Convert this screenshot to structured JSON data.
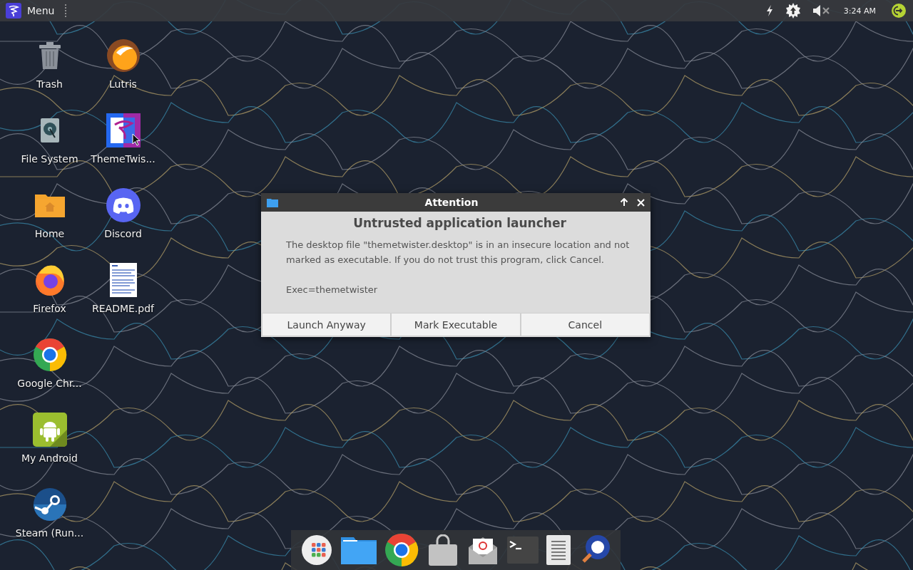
{
  "panel": {
    "menu_label": "Menu",
    "tray": [
      {
        "kind": "bolt"
      },
      {
        "kind": "update"
      },
      {
        "kind": "muted"
      }
    ],
    "clock": "3:24 AM"
  },
  "desktop_icons": [
    {
      "label": "Trash",
      "kind": "trash"
    },
    {
      "label": "File System",
      "kind": "drive"
    },
    {
      "label": "Home",
      "kind": "home"
    },
    {
      "label": "Firefox",
      "kind": "firefox"
    },
    {
      "label": "Google Chr...",
      "kind": "chrome"
    },
    {
      "label": "My Android",
      "kind": "android"
    },
    {
      "label": "Steam (Run...",
      "kind": "steam"
    },
    {
      "label": "Lutris",
      "kind": "lutris"
    },
    {
      "label": "ThemeTwis...",
      "kind": "theme"
    },
    {
      "label": "Discord",
      "kind": "discord"
    },
    {
      "label": "README.pdf",
      "kind": "document"
    }
  ],
  "dialog": {
    "title": "Attention",
    "heading": "Untrusted application launcher",
    "message": "The desktop file \"themetwister.desktop\" is in an insecure location and not marked as executable. If you do not trust this program, click Cancel.",
    "exec_line": "Exec=themetwister",
    "buttons": [
      "Launch Anyway",
      "Mark Executable",
      "Cancel"
    ]
  },
  "dock": [
    {
      "kind": "apps"
    },
    {
      "kind": "folder"
    },
    {
      "kind": "chrome"
    },
    {
      "kind": "store"
    },
    {
      "kind": "mail"
    },
    {
      "kind": "terminal"
    },
    {
      "kind": "text"
    },
    {
      "kind": "search"
    }
  ]
}
